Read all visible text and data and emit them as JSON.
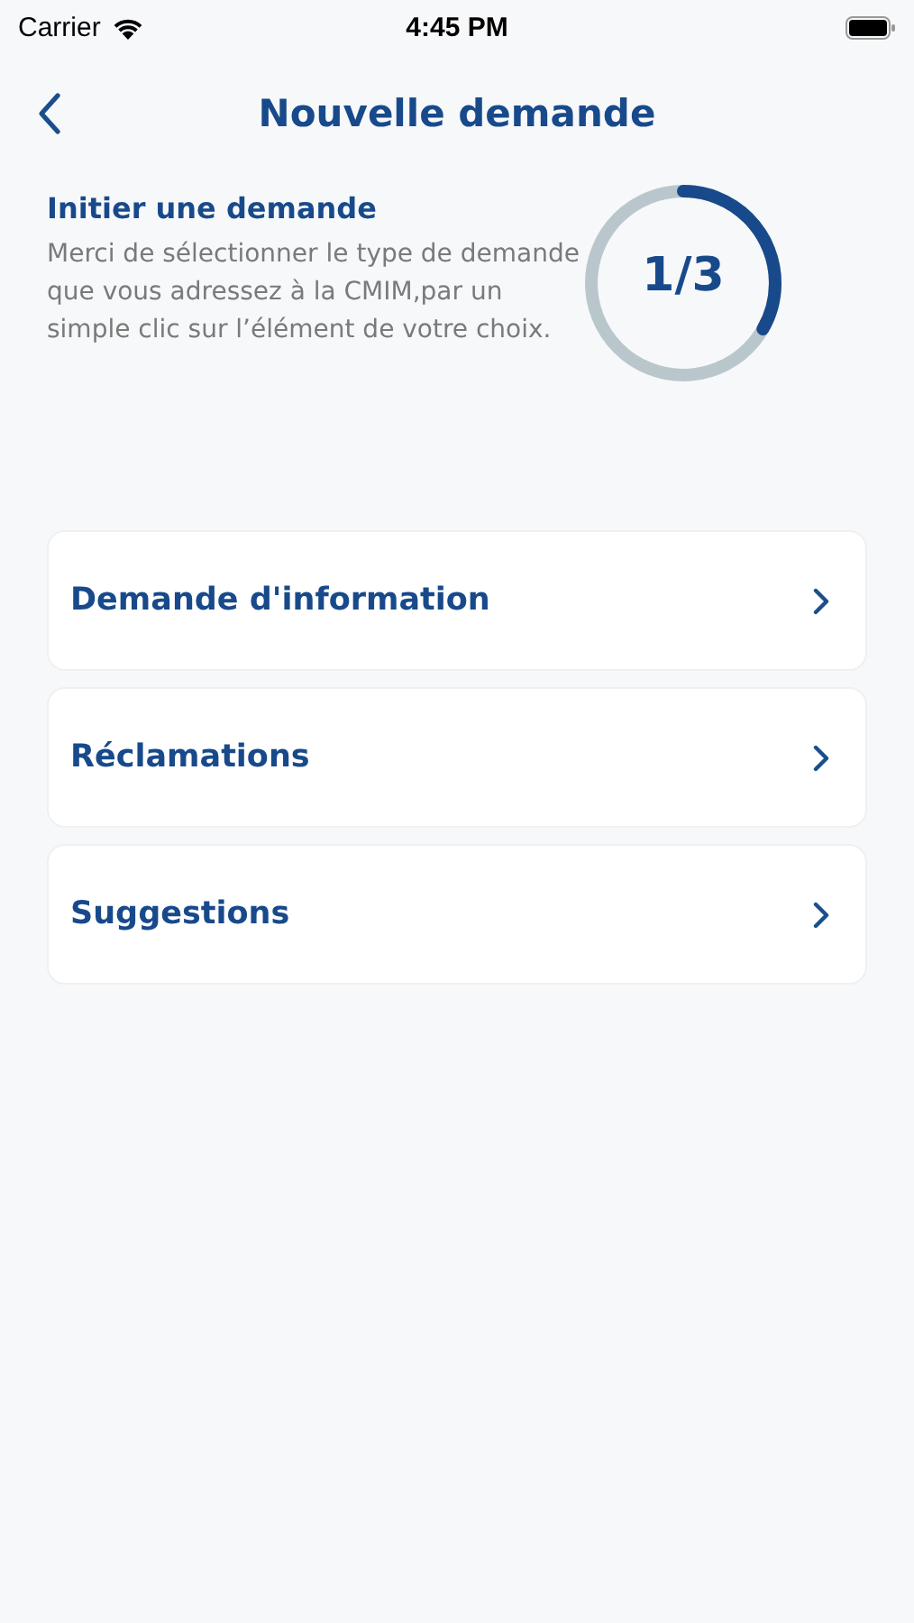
{
  "status_bar": {
    "carrier": "Carrier",
    "time": "4:45 PM"
  },
  "header": {
    "title": "Nouvelle demande"
  },
  "intro": {
    "title": "Initier une demande",
    "text": "Merci de sélectionner le type de demande que vous adressez à la CMIM,par un simple clic sur l’élément de votre choix.",
    "progress": {
      "label": "1/3",
      "level": 0.333
    }
  },
  "options": [
    {
      "label": "Demande d'information"
    },
    {
      "label": "Réclamations"
    },
    {
      "label": "Suggestions"
    }
  ]
}
